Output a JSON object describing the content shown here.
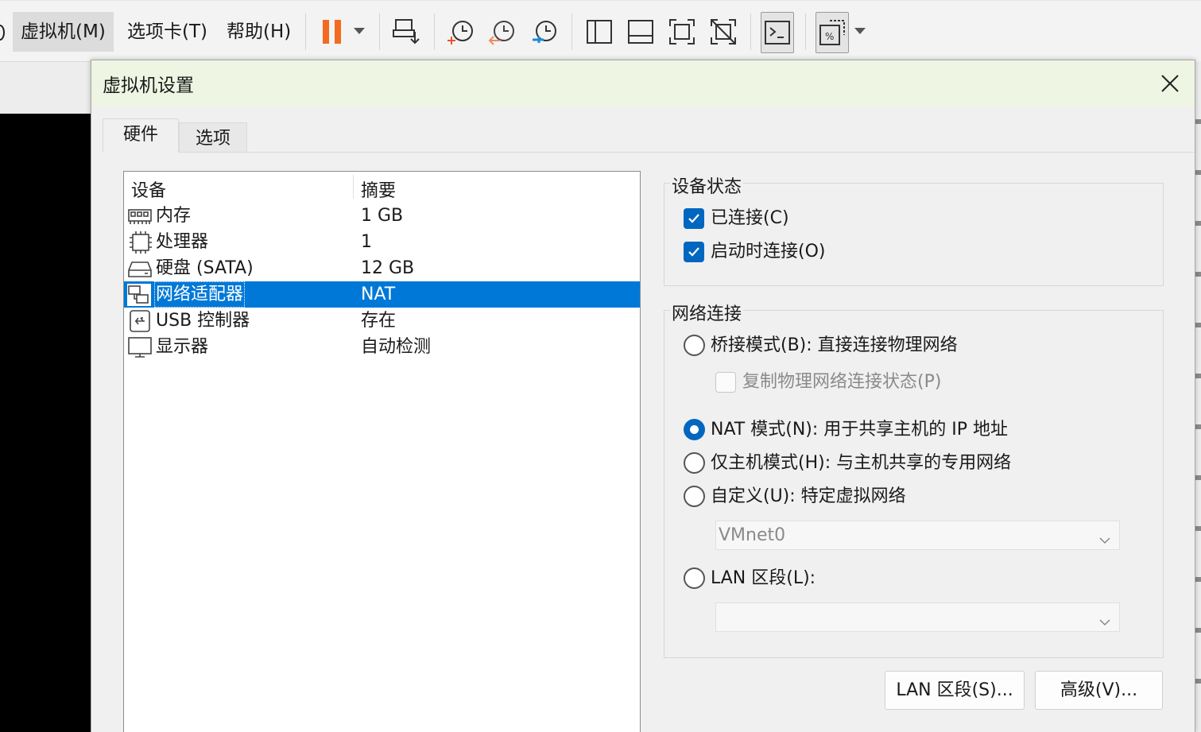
{
  "menu": {
    "vm": "虚拟机(M)",
    "tabs": "选项卡(T)",
    "help": "帮助(H)"
  },
  "toolbar_icons": [
    "pause-icon",
    "send-ctrl-alt-del-icon",
    "take-snapshot-icon",
    "revert-snapshot-icon",
    "snapshot-manager-icon",
    "show-library-icon",
    "thumbnail-bar-icon",
    "full-screen-icon",
    "unity-icon",
    "console-view-icon",
    "stretch-view-icon"
  ],
  "colors": {
    "accent": "#0067c0",
    "selection": "#0078d7",
    "pause": "#f26b21",
    "title_bg": "#eef6e3"
  },
  "dialog": {
    "title": "虚拟机设置",
    "tabs": {
      "hardware": "硬件",
      "options": "选项"
    },
    "device_list": {
      "columns": {
        "device": "设备",
        "summary": "摘要"
      },
      "rows": [
        {
          "icon": "memory-icon",
          "name": "内存",
          "summary": "1 GB"
        },
        {
          "icon": "processor-icon",
          "name": "处理器",
          "summary": "1"
        },
        {
          "icon": "hard-disk-icon",
          "name": "硬盘 (SATA)",
          "summary": "12 GB"
        },
        {
          "icon": "network-adapter-icon",
          "name": "网络适配器",
          "summary": "NAT",
          "selected": true
        },
        {
          "icon": "usb-icon",
          "name": "USB 控制器",
          "summary": "存在"
        },
        {
          "icon": "display-icon",
          "name": "显示器",
          "summary": "自动检测"
        }
      ]
    },
    "device_status": {
      "title": "设备状态",
      "connected": {
        "label": "已连接(C)",
        "checked": true
      },
      "connect_at_power_on": {
        "label": "启动时连接(O)",
        "checked": true
      }
    },
    "network_connection": {
      "title": "网络连接",
      "bridged": {
        "label": "桥接模式(B): 直接连接物理网络",
        "selected": false
      },
      "replicate": {
        "label": "复制物理网络连接状态(P)",
        "checked": false
      },
      "nat": {
        "label": "NAT 模式(N): 用于共享主机的 IP 地址",
        "selected": true
      },
      "host_only": {
        "label": "仅主机模式(H): 与主机共享的专用网络",
        "selected": false
      },
      "custom": {
        "label": "自定义(U): 特定虚拟网络",
        "selected": false
      },
      "custom_select": "VMnet0",
      "lan_segment": {
        "label": "LAN 区段(L):",
        "selected": false
      },
      "lan_select": ""
    },
    "buttons": {
      "lan_segments": "LAN 区段(S)...",
      "advanced": "高级(V)..."
    }
  }
}
